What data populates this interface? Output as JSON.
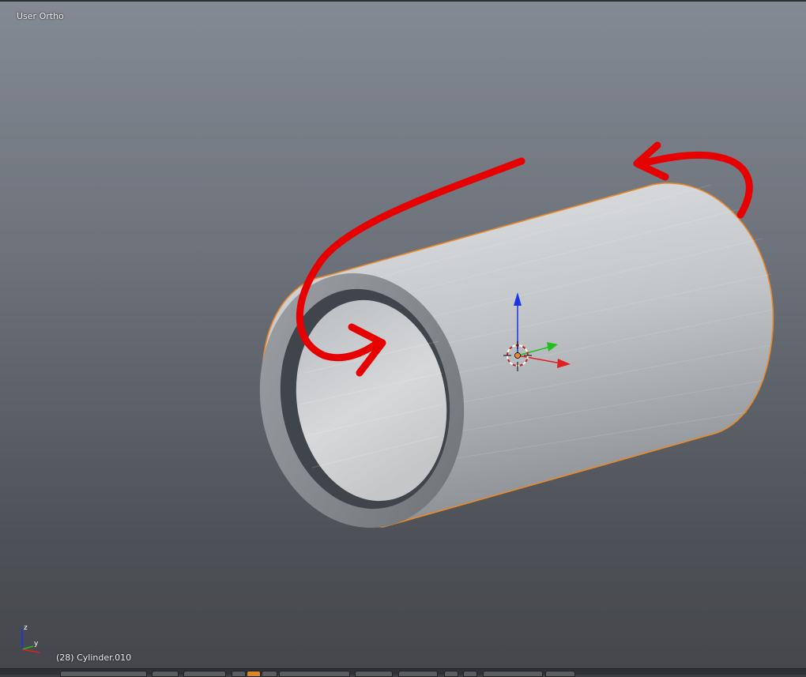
{
  "viewport": {
    "view_name": "User Ortho",
    "object_info": "(28) Cylinder.010"
  },
  "gizmo": {
    "z_label": "z",
    "y_label": "y"
  },
  "icons": {
    "cursor": "3d-cursor-icon",
    "transform": "transform-manipulator-icon",
    "axes": "view-axes-icon"
  },
  "colors": {
    "selection_outline": "#e8892a",
    "annotation_arrow": "#e60000",
    "axis_x": "#e02020",
    "axis_y": "#20c020",
    "axis_z": "#1a35e6"
  }
}
